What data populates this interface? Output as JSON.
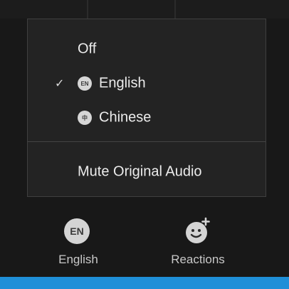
{
  "menu": {
    "items": [
      {
        "label": "Off",
        "checked": false,
        "icon": null
      },
      {
        "label": "English",
        "checked": true,
        "icon": "EN"
      },
      {
        "label": "Chinese",
        "checked": false,
        "icon": "中"
      }
    ],
    "mute_label": "Mute Original Audio"
  },
  "toolbar": {
    "language_badge": "EN",
    "language_label": "English",
    "reactions_label": "Reactions"
  },
  "colors": {
    "background": "#181818",
    "menu_bg": "#232323",
    "accent_strip": "#1f8fd8"
  }
}
